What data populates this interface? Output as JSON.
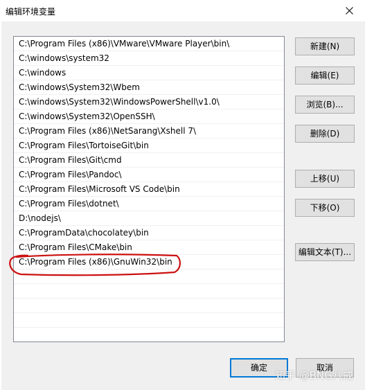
{
  "window": {
    "title": "编辑环境变量",
    "close_glyph": "✕"
  },
  "list": {
    "items": [
      "C:\\Program Files (x86)\\VMware\\VMware Player\\bin\\",
      "C:\\windows\\system32",
      "C:\\windows",
      "C:\\windows\\System32\\Wbem",
      "C:\\windows\\System32\\WindowsPowerShell\\v1.0\\",
      "C:\\windows\\System32\\OpenSSH\\",
      "C:\\Program Files (x86)\\NetSarang\\Xshell 7\\",
      "C:\\Program Files\\TortoiseGit\\bin",
      "C:\\Program Files\\Git\\cmd",
      "C:\\Program Files\\Pandoc\\",
      "C:\\Program Files\\Microsoft VS Code\\bin",
      "C:\\Program Files\\dotnet\\",
      "D:\\nodejs\\",
      "C:\\ProgramData\\chocolatey\\bin",
      "C:\\Program Files\\CMake\\bin",
      "C:\\Program Files (x86)\\GnuWin32\\bin"
    ],
    "highlighted_index": 15
  },
  "buttons": {
    "new": "新建(N)",
    "edit": "编辑(E)",
    "browse": "浏览(B)...",
    "delete": "删除(D)",
    "move_up": "上移(U)",
    "move_down": "下移(O)",
    "edit_text": "编辑文本(T)...",
    "ok": "确定",
    "cancel": "取消"
  },
  "watermark": "知乎 @BNG八戒",
  "colors": {
    "annotation_circle": "#cc1010",
    "dialog_background": "#f0f0f0",
    "button_face": "#e1e1e1",
    "default_button_border": "#0078d7"
  }
}
